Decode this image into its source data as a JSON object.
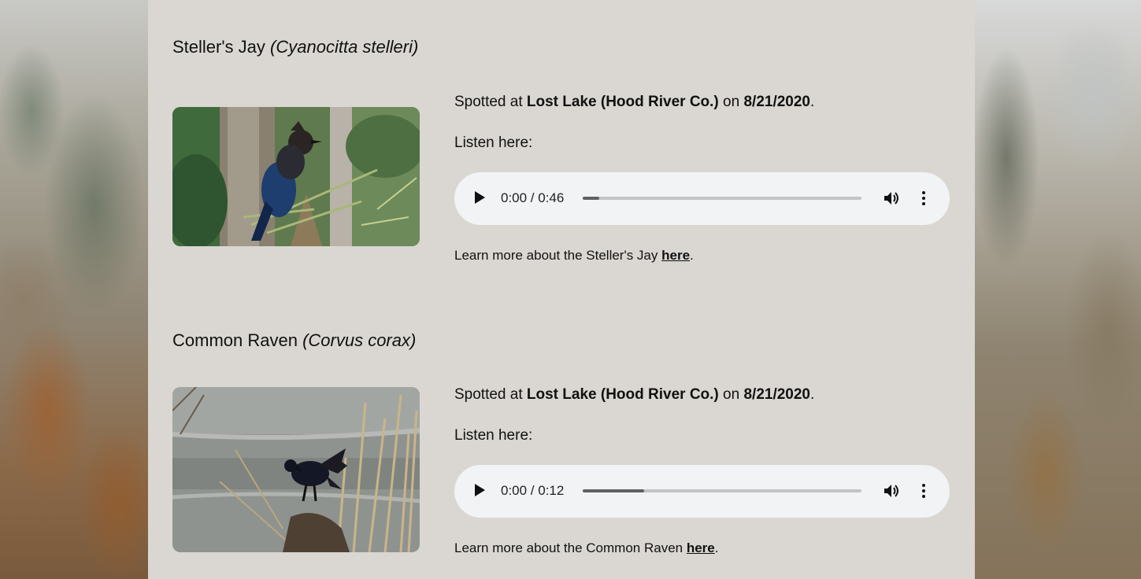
{
  "birds": [
    {
      "common_name": "Steller's Jay",
      "scientific_name": "(Cyanocitta stelleri)",
      "photo_icon": "stellers-jay-photo",
      "spotted_prefix": "Spotted at ",
      "location": "Lost Lake (Hood River Co.)",
      "on": " on ",
      "date": "8/21/2020",
      "period": ".",
      "listen_label": "Listen here:",
      "audio_time": "0:00 / 0:46",
      "audio_progress": 0.06,
      "learn_prefix": "Learn more about the Steller's Jay ",
      "learn_link": "here",
      "learn_suffix": "."
    },
    {
      "common_name": "Common Raven",
      "scientific_name": "(Corvus corax)",
      "photo_icon": "common-raven-photo",
      "spotted_prefix": "Spotted at ",
      "location": "Lost Lake (Hood River Co.)",
      "on": " on ",
      "date": "8/21/2020",
      "period": ".",
      "listen_label": "Listen here:",
      "audio_time": "0:00 / 0:12",
      "audio_progress": 0.22,
      "learn_prefix": "Learn more about the Common Raven ",
      "learn_link": "here",
      "learn_suffix": "."
    }
  ]
}
